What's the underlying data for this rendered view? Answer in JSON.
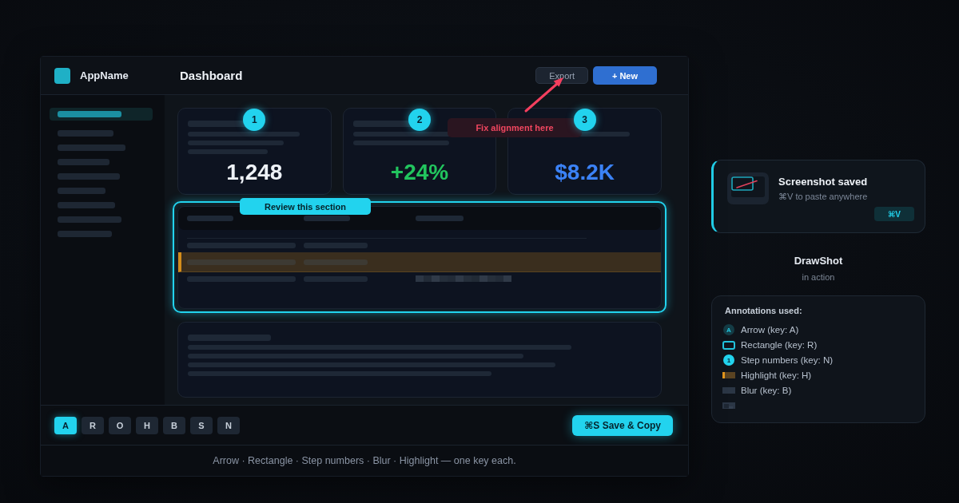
{
  "app": {
    "app_name": "AppName",
    "page_title": "Dashboard",
    "export_button": {
      "label": "Export"
    },
    "new_button": {
      "label": "+ New"
    },
    "sidebar": {
      "items": [
        {
          "selected": true
        },
        {
          "selected": false
        },
        {
          "selected": false
        },
        {
          "selected": false
        },
        {
          "selected": false
        },
        {
          "selected": false
        },
        {
          "selected": false
        },
        {
          "selected": false
        },
        {
          "selected": false
        }
      ]
    },
    "stat_cards": [
      {
        "step": "1",
        "value": "1,248",
        "color": "#eef2f7"
      },
      {
        "step": "2",
        "value": "+24%",
        "color": "#22c55e"
      },
      {
        "step": "3",
        "value": "$8.2K",
        "color": "#3b82f6"
      }
    ],
    "arrow_callout": {
      "text": "Fix alignment here"
    },
    "focus_rectangle": {
      "label": "Review this section"
    },
    "table": {
      "rows": [
        {
          "highlighted": false,
          "blurred": false
        },
        {
          "highlighted": true,
          "blurred": false
        },
        {
          "highlighted": false,
          "blurred": true
        }
      ]
    },
    "toolbar": {
      "keys": [
        {
          "label": "A",
          "selected": true
        },
        {
          "label": "R",
          "selected": false
        },
        {
          "label": "O",
          "selected": false
        },
        {
          "label": "H",
          "selected": false
        },
        {
          "label": "B",
          "selected": false
        },
        {
          "label": "S",
          "selected": false
        },
        {
          "label": "N",
          "selected": false
        }
      ],
      "save_button": {
        "label": "⌘S Save & Copy"
      }
    },
    "caption": "Arrow · Rectangle · Step numbers · Blur · Highlight — one key each."
  },
  "toast": {
    "title": "Screenshot saved",
    "subtitle": "⌘V to paste anywhere",
    "shortcut": "⌘V"
  },
  "product": {
    "name": "DrawShot",
    "tagline": "in action"
  },
  "legend": {
    "title": "Annotations used:",
    "items": [
      {
        "kind": "arrow",
        "glyph": "A",
        "label": "Arrow (key: A)"
      },
      {
        "kind": "rectangle",
        "label": "Rectangle (key: R)"
      },
      {
        "kind": "step",
        "glyph": "1",
        "label": "Step numbers (key: N)"
      },
      {
        "kind": "highlight",
        "label": "Highlight (key: H)"
      },
      {
        "kind": "blur",
        "label": "Blur (key: B)"
      },
      {
        "kind": "pixelate"
      }
    ]
  }
}
